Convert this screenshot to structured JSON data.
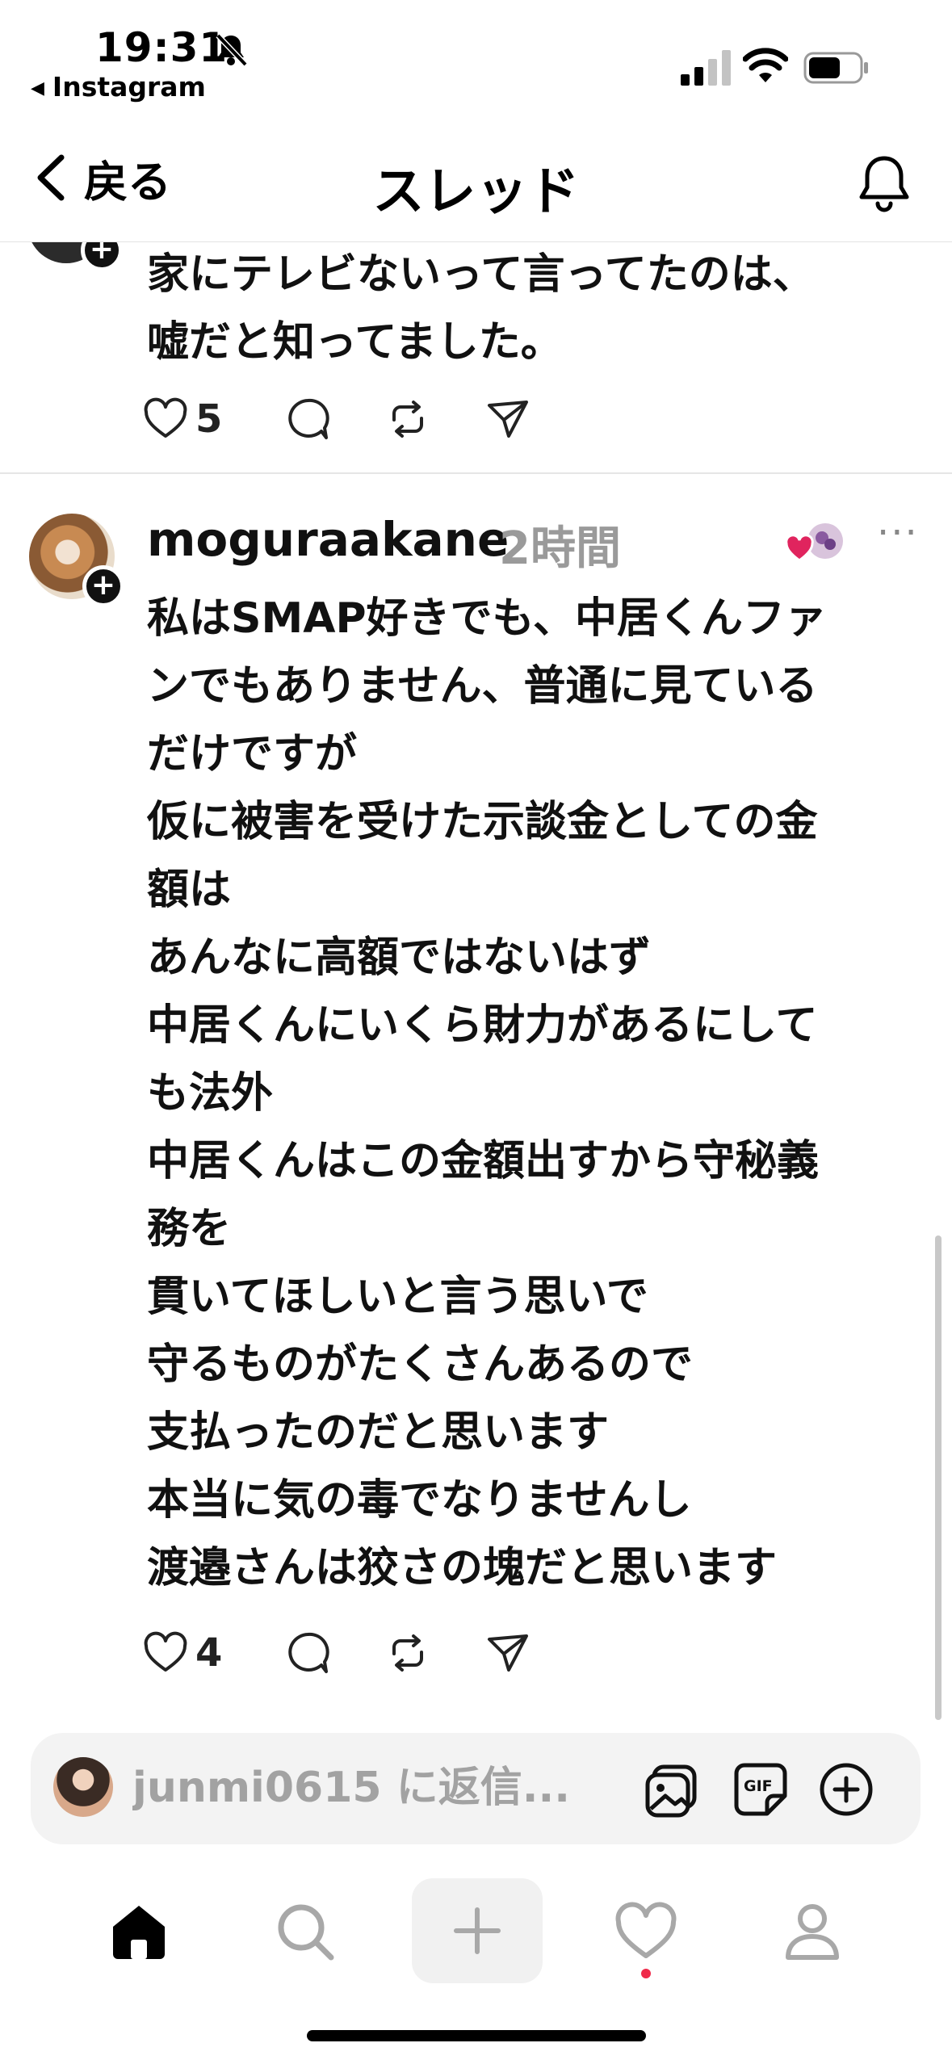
{
  "status_bar": {
    "time": "19:31",
    "back_app": "Instagram"
  },
  "header": {
    "back_label": "戻る",
    "title": "スレッド"
  },
  "previous_post": {
    "text": "家にテレビないって言ってたのは、\n嘘だと知ってました。",
    "like_count": "5"
  },
  "post": {
    "username": "moguraakane",
    "timestamp": "2時間",
    "text": "私はSMAP好きでも、中居くんファ\nンでもありません、普通に見ている\nだけですが\n仮に被害を受けた示談金としての金\n額は\nあんなに高額ではないはず\n中居くんにいくら財力があるにして\nも法外\n中居くんはこの金額出すから守秘義\n務を\n貫いてほしいと言う思いで\n守るものがたくさんあるので\n支払ったのだと思います\n本当に気の毒でなりませんし\n渡邉さんは狡さの塊だと思います",
    "like_count": "4",
    "plus_symbol": "+",
    "more_symbol": "···"
  },
  "reply": {
    "placeholder": "junmi0615 に返信..."
  },
  "icons": {
    "like": "heart-icon",
    "comment": "comment-bubble-icon",
    "repost": "repost-icon",
    "share": "send-icon",
    "image": "image-icon",
    "gif": "gif-icon",
    "add": "plus-circle-icon"
  },
  "colors": {
    "muted": "#9a9a9a",
    "notification_dot": "#ef2a4a",
    "liked_heart": "#e0245e"
  }
}
